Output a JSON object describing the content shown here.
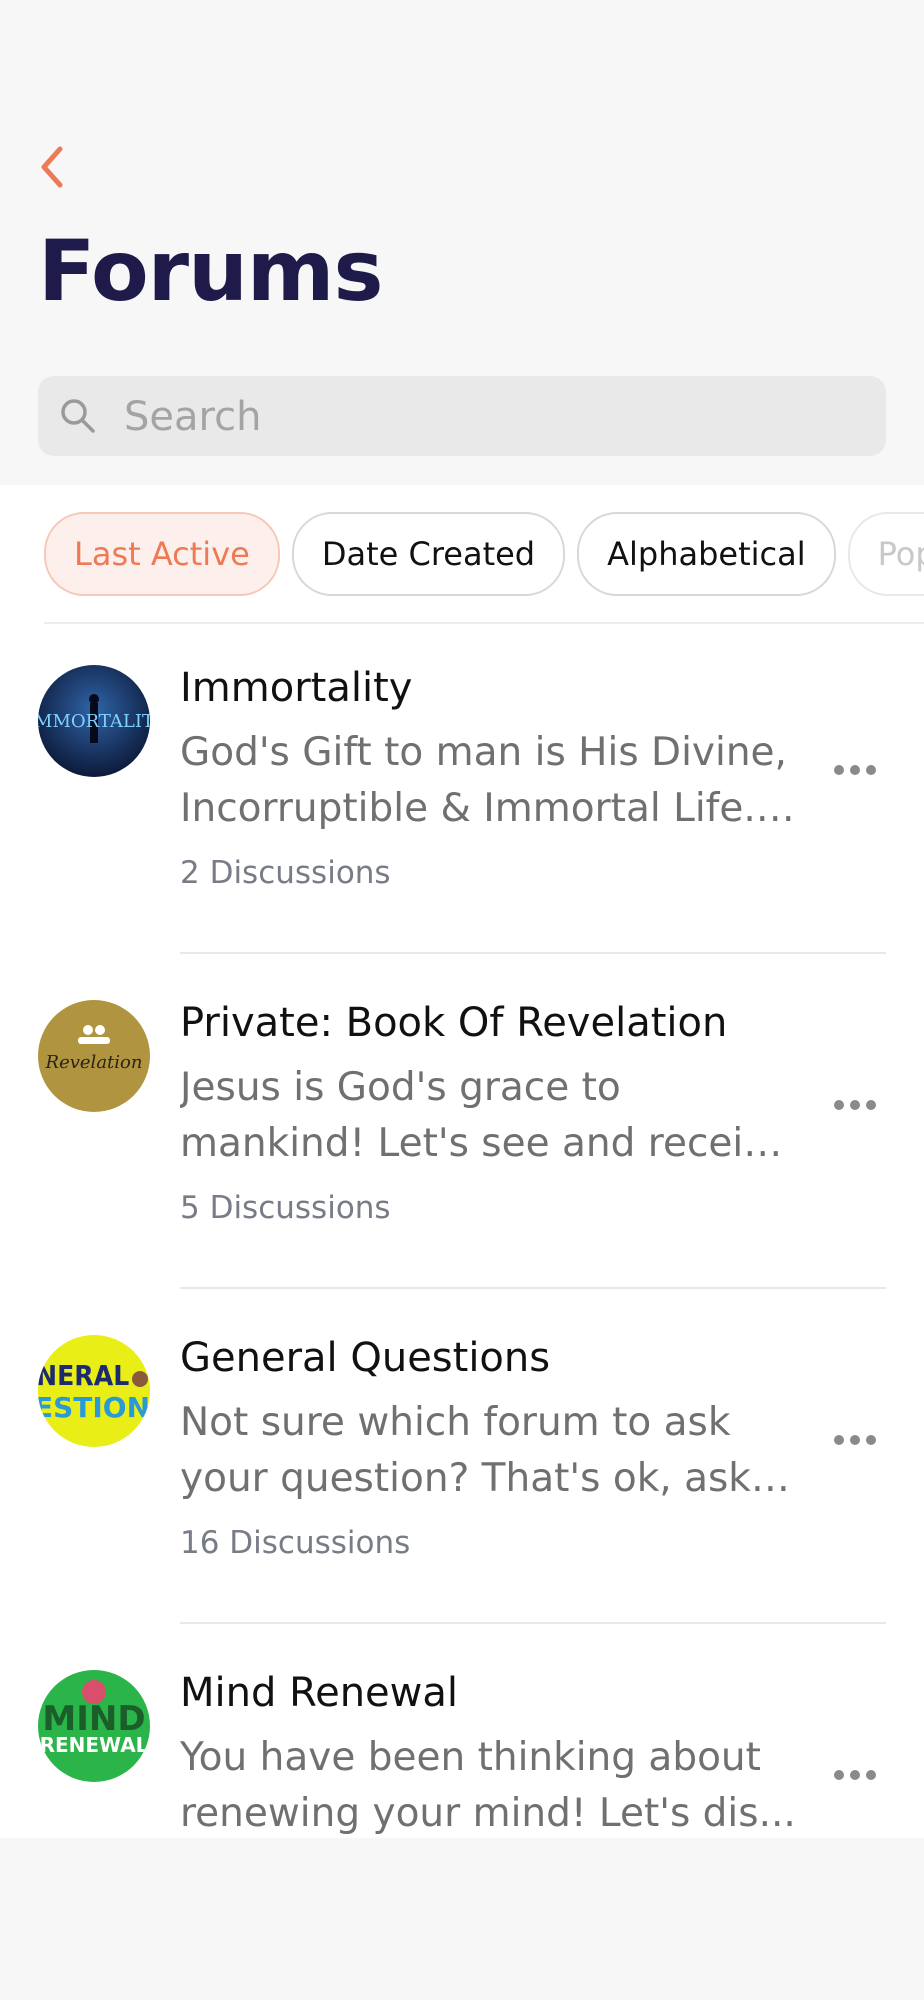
{
  "header": {
    "back_icon": "chevron-left-icon",
    "title": "Forums",
    "accent_color": "#ee7a55",
    "title_color": "#1e1a49"
  },
  "search": {
    "placeholder": "Search",
    "value": "",
    "icon": "search-icon"
  },
  "filters": [
    {
      "label": "Last Active",
      "active": true
    },
    {
      "label": "Date Created",
      "active": false
    },
    {
      "label": "Alphabetical",
      "active": false
    },
    {
      "label": "Pop",
      "active": false
    }
  ],
  "forums": [
    {
      "name": "Immortality",
      "description_lines": [
        "God's Gift to man is His Divine,",
        "Incorruptible & Immortal Life. ..."
      ],
      "count": "2 Discussions",
      "avatar_text": "MMORTALIT",
      "avatar_colors": [
        "#0d1a3a",
        "#2f64a8"
      ]
    },
    {
      "name": "Private: Book Of Revelation",
      "description_lines": [
        "Jesus is God's grace to",
        "mankind! Let's see and receiv..."
      ],
      "count": "5 Discussions",
      "avatar_text": "Revelation",
      "avatar_colors": [
        "#b0943f",
        "#2a2414"
      ]
    },
    {
      "name": "General Questions",
      "description_lines": [
        "Not sure which forum to ask",
        "your question? That's ok, ask ..."
      ],
      "count": "16 Discussions",
      "avatar_text": "NERAL ESTIONS",
      "avatar_colors": [
        "#e9ee17",
        "#1c2b6e"
      ]
    },
    {
      "name": "Mind Renewal",
      "description_lines": [
        "You have been thinking about",
        "renewing your mind! Let's dis..."
      ],
      "count": "",
      "avatar_text": "MIND RENEWAL",
      "avatar_colors": [
        "#2bb44a",
        "#ffffff"
      ]
    }
  ]
}
